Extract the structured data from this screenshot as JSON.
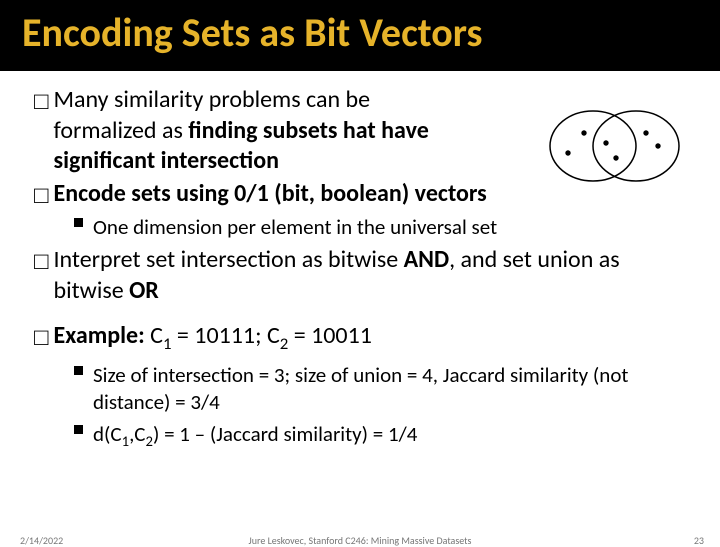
{
  "slide": {
    "title": "Encoding Sets as Bit Vectors",
    "bullets": {
      "b1_part1": "Many similarity problems can be formalized as ",
      "b1_bold": "finding subsets hat have significant intersection",
      "b2_bold": "Encode sets using 0/1 (bit, boolean) vectors",
      "s1": "One dimension per element in the universal set",
      "b3_part1": "Interpret set intersection as bitwise ",
      "b3_and": "AND",
      "b3_part2": ", and set union as bitwise ",
      "b3_or": "OR",
      "b4_label": "Example:",
      "b4_c1lbl": " C",
      "b4_sub1": "1",
      "b4_eq1": " = 10111; C",
      "b4_sub2": "2",
      "b4_eq2": " = 10011",
      "s2": "Size of intersection = 3; size of union = 4, Jaccard similarity (not distance) = 3/4",
      "s3a": "d(C",
      "s3s1": "1",
      "s3b": ",C",
      "s3s2": "2",
      "s3c": ") = 1 – (Jaccard similarity) = 1/4"
    },
    "footer": {
      "date": "2/14/2022",
      "source": "Jure Leskovec, Stanford C246: Mining Massive Datasets",
      "page": "23"
    },
    "glyph": {
      "box": "□"
    }
  }
}
